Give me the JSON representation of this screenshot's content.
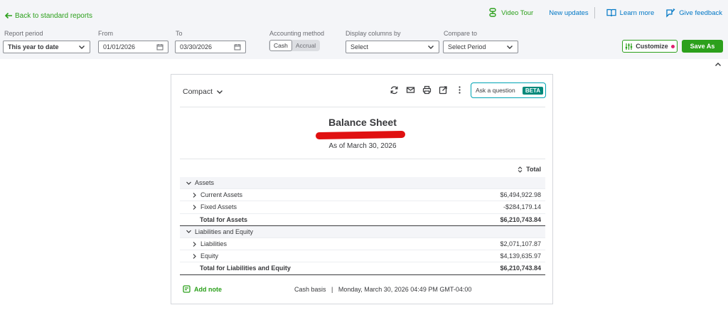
{
  "nav": {
    "back_label": "Back to standard reports"
  },
  "toplinks": {
    "video_tour": "Video Tour",
    "new_updates": "New updates",
    "learn_more": "Learn more",
    "give_feedback": "Give feedback"
  },
  "filters": {
    "report_period_label": "Report period",
    "report_period_value": "This year to date",
    "from_label": "From",
    "from_value": "01/01/2026",
    "to_label": "To",
    "to_value": "03/30/2026",
    "accounting_label": "Accounting method",
    "accounting_cash": "Cash",
    "accounting_accrual": "Accrual",
    "display_label": "Display columns by",
    "display_value": "Select",
    "compare_label": "Compare to",
    "compare_value": "Select Period",
    "customize_label": "Customize",
    "save_label": "Save As"
  },
  "report": {
    "view_label": "Compact",
    "ask_label": "Ask a question",
    "beta_label": "BETA",
    "title": "Balance Sheet",
    "as_of": "As of March 30, 2026",
    "column_header": "Total",
    "rows": [
      {
        "label": "Assets",
        "value": ""
      },
      {
        "label": "Current Assets",
        "value": "$6,494,922.98"
      },
      {
        "label": "Fixed Assets",
        "value": "-$284,179.14"
      },
      {
        "label": "Total for Assets",
        "value": "$6,210,743.84"
      },
      {
        "label": "Liabilities and Equity",
        "value": ""
      },
      {
        "label": "Liabilities",
        "value": "$2,071,107.87"
      },
      {
        "label": "Equity",
        "value": "$4,139,635.97"
      },
      {
        "label": "Total for Liabilities and Equity",
        "value": "$6,210,743.84"
      }
    ],
    "add_note": "Add note",
    "basis": "Cash basis",
    "timestamp": "Monday, March 30, 2026 04:49 PM GMT-04:00"
  },
  "colors": {
    "brand_green": "#2ca01c",
    "link_blue": "#0077c5",
    "redaction": "#e01010"
  }
}
